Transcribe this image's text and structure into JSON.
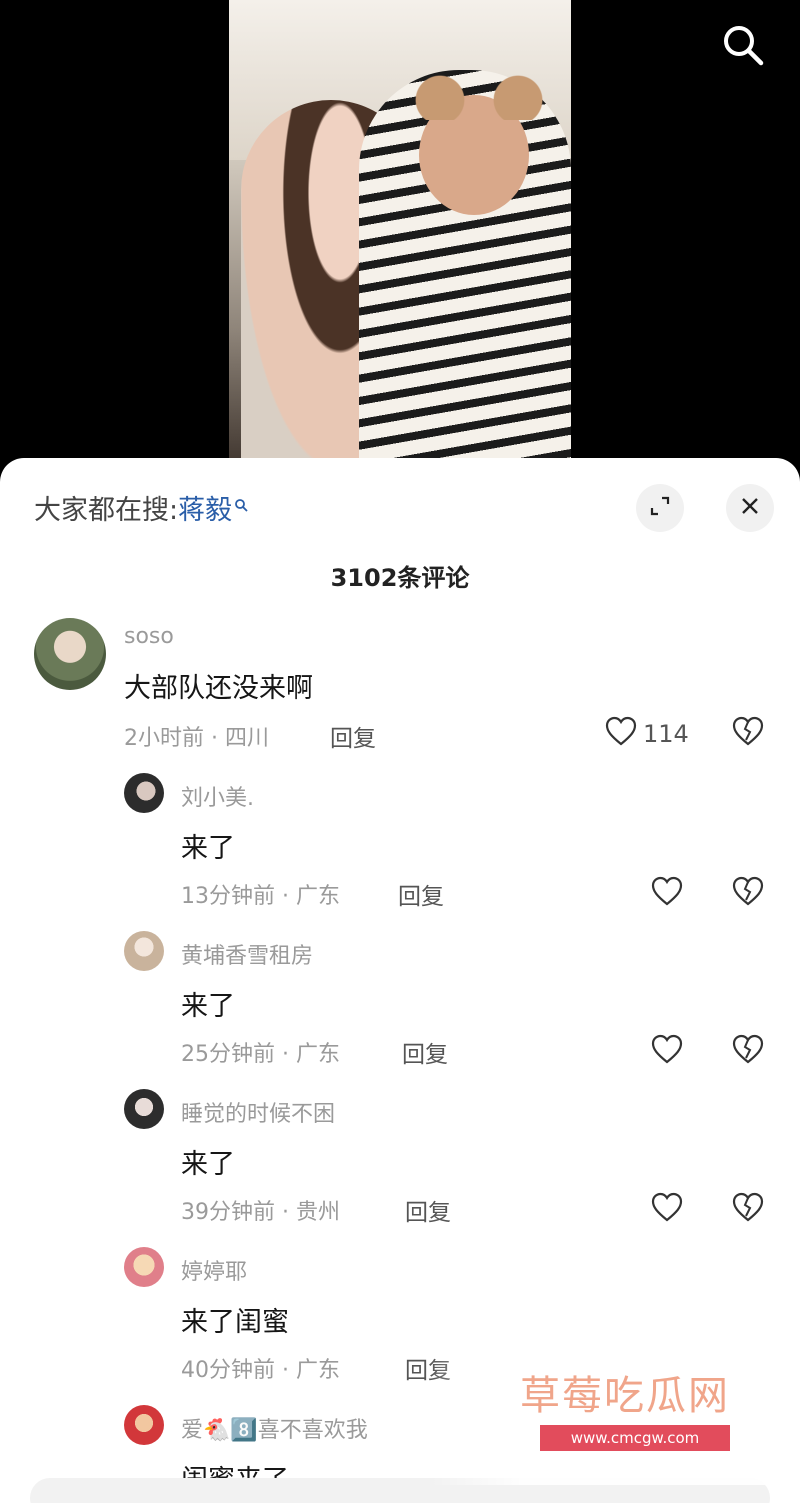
{
  "search_bar": {
    "prefix": "大家都在搜:",
    "keyword": "蒋毅"
  },
  "comment_count": "3102条评论",
  "comments": [
    {
      "user": "soso",
      "text": "大部队还没来啊",
      "time_location": "2小时前 · 四川",
      "reply": "回复",
      "likes": "114"
    },
    {
      "user": "刘小美.",
      "text": "来了",
      "time_location": "13分钟前 · 广东",
      "reply": "回复"
    },
    {
      "user": "黄埔香雪租房",
      "text": "来了",
      "time_location": "25分钟前 · 广东",
      "reply": "回复"
    },
    {
      "user": "睡觉的时候不困",
      "text": "来了",
      "time_location": "39分钟前 · 贵州",
      "reply": "回复"
    },
    {
      "user": "婷婷耶",
      "text": "来了闺蜜",
      "time_location": "40分钟前 · 广东",
      "reply": "回复"
    },
    {
      "user": "爱🐔8️⃣喜不喜欢我",
      "text": "闺蜜来了"
    }
  ],
  "watermark": {
    "title": "草莓吃瓜网",
    "url": "www.cmcgw.com"
  },
  "icons": [
    "search-icon",
    "expand-icon",
    "close-icon",
    "heart-icon",
    "broken-heart-icon"
  ]
}
